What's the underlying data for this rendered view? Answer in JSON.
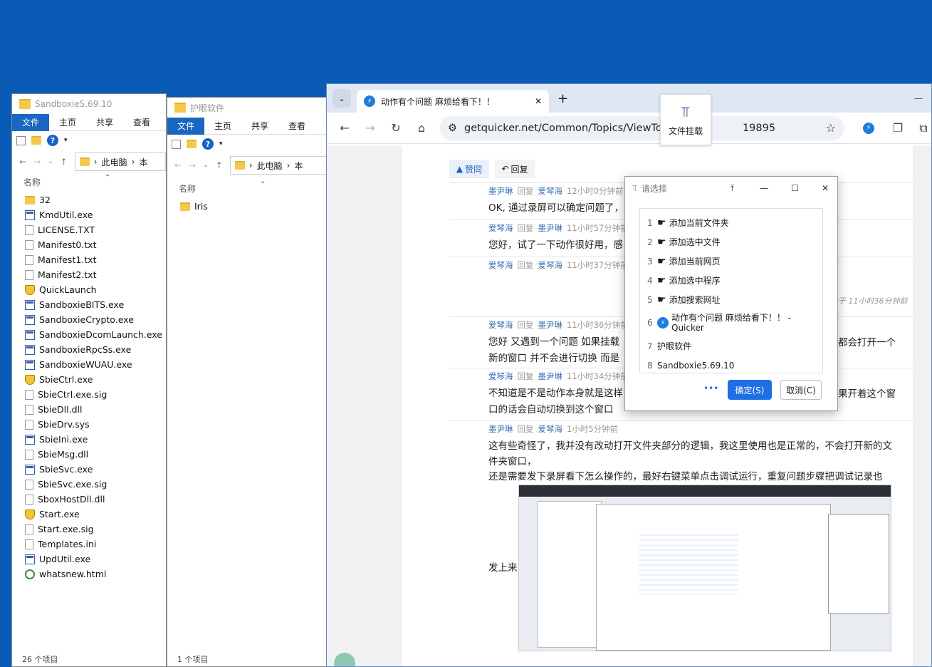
{
  "explorer1": {
    "title": "Sandboxie5.69.10",
    "ribbon": [
      "文件",
      "主页",
      "共享",
      "查看"
    ],
    "breadcrumb": [
      "此电脑",
      "本"
    ],
    "column_name": "名称",
    "files": [
      {
        "name": "32",
        "icon": "folder"
      },
      {
        "name": "KmdUtil.exe",
        "icon": "exe"
      },
      {
        "name": "LICENSE.TXT",
        "icon": "txt"
      },
      {
        "name": "Manifest0.txt",
        "icon": "txt"
      },
      {
        "name": "Manifest1.txt",
        "icon": "txt"
      },
      {
        "name": "Manifest2.txt",
        "icon": "txt"
      },
      {
        "name": "QuickLaunch",
        "icon": "shield"
      },
      {
        "name": "SandboxieBITS.exe",
        "icon": "exe"
      },
      {
        "name": "SandboxieCrypto.exe",
        "icon": "exe"
      },
      {
        "name": "SandboxieDcomLaunch.exe",
        "icon": "exe"
      },
      {
        "name": "SandboxieRpcSs.exe",
        "icon": "exe"
      },
      {
        "name": "SandboxieWUAU.exe",
        "icon": "exe"
      },
      {
        "name": "SbieCtrl.exe",
        "icon": "shield"
      },
      {
        "name": "SbieCtrl.exe.sig",
        "icon": "txt"
      },
      {
        "name": "SbieDll.dll",
        "icon": "txt"
      },
      {
        "name": "SbieDrv.sys",
        "icon": "txt"
      },
      {
        "name": "SbieIni.exe",
        "icon": "exe"
      },
      {
        "name": "SbieMsg.dll",
        "icon": "txt"
      },
      {
        "name": "SbieSvc.exe",
        "icon": "exe"
      },
      {
        "name": "SbieSvc.exe.sig",
        "icon": "txt"
      },
      {
        "name": "SboxHostDll.dll",
        "icon": "txt"
      },
      {
        "name": "Start.exe",
        "icon": "shield"
      },
      {
        "name": "Start.exe.sig",
        "icon": "txt"
      },
      {
        "name": "Templates.ini",
        "icon": "txt"
      },
      {
        "name": "UpdUtil.exe",
        "icon": "exe"
      },
      {
        "name": "whatsnew.html",
        "icon": "html"
      }
    ],
    "status": "26 个项目"
  },
  "explorer2": {
    "title": "护眼软件",
    "ribbon": [
      "文件",
      "主页",
      "共享",
      "查看"
    ],
    "breadcrumb": [
      "此电脑",
      "本"
    ],
    "column_name": "名称",
    "files": [
      {
        "name": "Iris",
        "icon": "folder"
      }
    ],
    "status": "1 个项目"
  },
  "browser": {
    "tab_title": "动作有个问题 麻烦给看下！！",
    "url_left": "getquicker.net/Common/Topics/ViewTopi",
    "url_right": "19895",
    "hang_label": "文件挂载",
    "like": "赞同",
    "reply": "回复",
    "posts": [
      {
        "author": "墨尹琳",
        "to": "爱琴海",
        "time": "12小时0分钟前",
        "text": "OK, 通过录屏可以确定问题了，"
      },
      {
        "author": "爱琴海",
        "to": "墨尹琳",
        "time": "11小时57分钟前",
        "text": "您好，试了一下动作很好用，感"
      },
      {
        "author": "爱琴海",
        "to": "爱琴海",
        "time": "11小时37分钟前",
        "text": ""
      },
      {
        "author": "爱琴海",
        "to": "墨尹琳",
        "time": "11小时36分钟前",
        "text": "您好 又遇到一个问题 如果挂载"
      },
      {
        "author": "爱琴海",
        "to": "墨尹琳",
        "time": "11小时34分钟前",
        "text": "不知道是不是动作本身就是这样"
      },
      {
        "author": "墨尹琳",
        "to": "爱琴海",
        "time": "1小时5分钟前",
        "text": "这有些奇怪了，我并没有改动打开文件夹部分的逻辑，我这里使用也是正常的，不会打开新的文件夹窗口，"
      }
    ],
    "right_fragments": {
      "reply_note": "于 11小时36分钟前",
      "p4_right": "都会打开一个",
      "p4_line2": "新的窗口 并不会进行切换 而是",
      "p5_right": "果开着这个窗",
      "p5_line2": "口的话会自动切换到这个窗口 ",
      "p6_line2": "还是需要发下录屏看下怎么操作的，最好右键菜单点击调试运行，重复问题步骤把调试记录也",
      "p6_line3": "发上来"
    }
  },
  "dialog": {
    "title": "请选择",
    "items": [
      {
        "num": "1",
        "icon": "thumb",
        "label": "添加当前文件夹"
      },
      {
        "num": "2",
        "icon": "thumb",
        "label": "添加选中文件"
      },
      {
        "num": "3",
        "icon": "thumb",
        "label": "添加当前网页"
      },
      {
        "num": "4",
        "icon": "thumb",
        "label": "添加选中程序"
      },
      {
        "num": "5",
        "icon": "thumb",
        "label": "添加搜索网址"
      },
      {
        "num": "6",
        "icon": "quicker",
        "label": "动作有个问题 麻烦给看下！！ - Quicker"
      },
      {
        "num": "7",
        "icon": "",
        "label": "护眼软件"
      },
      {
        "num": "8",
        "icon": "",
        "label": "Sandboxie5.69.10"
      }
    ],
    "more": "•••",
    "ok": "确定(S)",
    "cancel": "取消(C)"
  }
}
